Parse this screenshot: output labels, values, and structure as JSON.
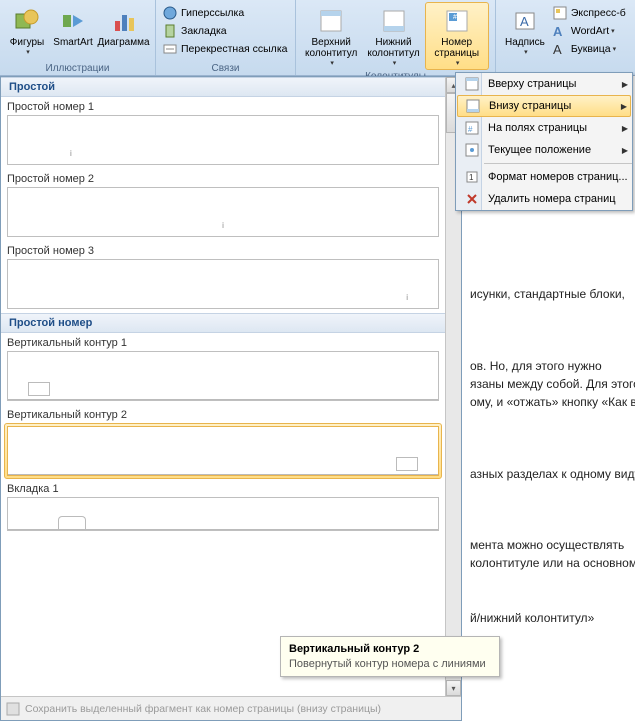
{
  "ribbon": {
    "groups": {
      "illustrations": {
        "label": "Иллюстрации",
        "shapes": "Фигуры",
        "smartart": "SmartArt",
        "chart": "Диаграмма"
      },
      "links": {
        "label": "Связи",
        "hyperlink": "Гиперссылка",
        "bookmark": "Закладка",
        "crossref": "Перекрестная ссылка"
      },
      "headers": {
        "label": "Колонтитулы",
        "header": "Верхний\nколонтитул",
        "footer": "Нижний\nколонтитул",
        "pagenum": "Номер\nстраницы"
      },
      "text": {
        "textbox": "Надпись",
        "quickparts": "Экспресс-б",
        "wordart": "WordArt",
        "dropcap": "Буквица"
      }
    }
  },
  "submenu": {
    "top_of_page": "Вверху страницы",
    "bottom_of_page": "Внизу страницы",
    "page_margins": "На полях страницы",
    "current_position": "Текущее положение",
    "format": "Формат номеров страниц...",
    "remove": "Удалить номера страниц"
  },
  "gallery": {
    "cat_simple": "Простой",
    "items_simple": [
      "Простой номер 1",
      "Простой номер 2",
      "Простой номер 3"
    ],
    "cat_simple_number": "Простой номер",
    "items_contour": [
      "Вертикальный контур 1",
      "Вертикальный контур 2"
    ],
    "item_tab": "Вкладка 1",
    "footer": "Сохранить выделенный фрагмент как номер страницы (внизу страницы)"
  },
  "tooltip": {
    "title": "Вертикальный контур 2",
    "desc": "Повернутый контур номера с линиями"
  },
  "doc_lines": [
    "исунки, стандартные блоки,",
    "ов. Но, для этого нужно",
    "язаны между собой. Для этого",
    "ому, и «отжать» кнопку «Как в",
    "азных разделах к одному виду,",
    "мента можно осуществлять",
    "колонтитуле или на основном",
    "й/нижний колонтитул»"
  ]
}
